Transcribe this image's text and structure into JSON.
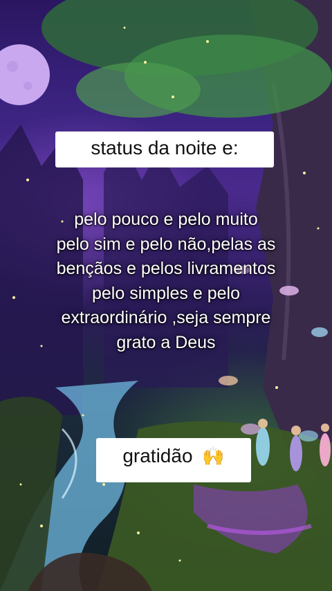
{
  "title_text": "status da noite e:",
  "body_lines": [
    "pelo pouco e pelo muito",
    "pelo sim e pelo não,pelas as",
    "bençãos e pelos livramentos",
    "pelo simples e pelo",
    "extraordinário ,seja sempre",
    "grato a Deus"
  ],
  "footer": {
    "text": "gratidão",
    "icon": "raised-hands-icon",
    "glyph": "🙌"
  },
  "colors": {
    "caption_bg": "#ffffff",
    "caption_text": "#111111",
    "body_text": "#ffffff",
    "sky": "#3b2380",
    "moon": "#c9a8f0"
  }
}
